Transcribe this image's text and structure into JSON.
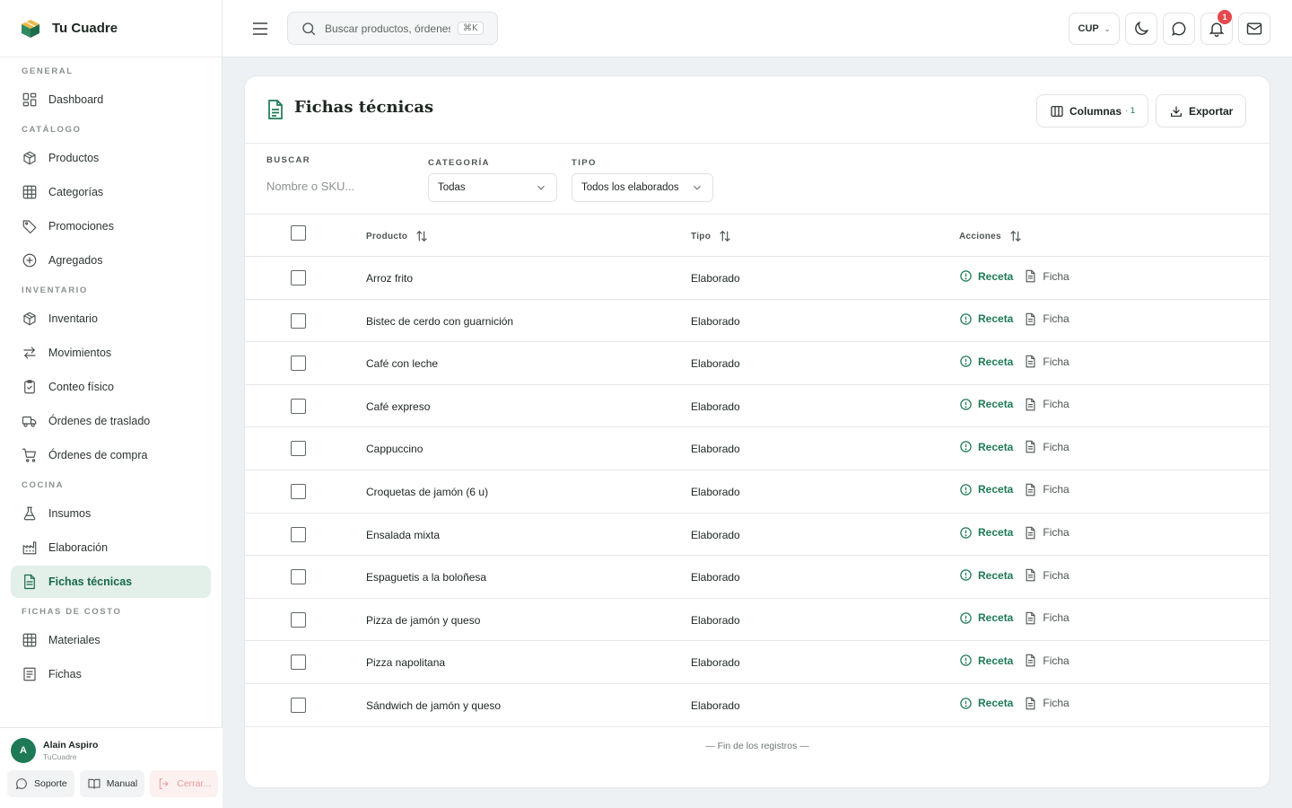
{
  "brand": {
    "name": "Tu Cuadre"
  },
  "sidebar": {
    "sections": [
      {
        "title": "GENERAL",
        "items": [
          {
            "label": "Dashboard",
            "icon": "dashboard-icon"
          }
        ]
      },
      {
        "title": "CATÁLOGO",
        "items": [
          {
            "label": "Productos",
            "icon": "box-icon"
          },
          {
            "label": "Categorías",
            "icon": "grid-icon"
          },
          {
            "label": "Promociones",
            "icon": "tag-icon"
          },
          {
            "label": "Agregados",
            "icon": "plus-circle-icon"
          }
        ]
      },
      {
        "title": "INVENTARIO",
        "items": [
          {
            "label": "Inventario",
            "icon": "box-icon"
          },
          {
            "label": "Movimientos",
            "icon": "arrows-icon"
          },
          {
            "label": "Conteo físico",
            "icon": "clipboard-icon"
          },
          {
            "label": "Órdenes de traslado",
            "icon": "truck-icon"
          },
          {
            "label": "Órdenes de compra",
            "icon": "cart-icon"
          }
        ]
      },
      {
        "title": "COCINA",
        "items": [
          {
            "label": "Insumos",
            "icon": "flask-icon"
          },
          {
            "label": "Elaboración",
            "icon": "factory-icon"
          },
          {
            "label": "Fichas técnicas",
            "icon": "document-icon",
            "active": true
          }
        ]
      },
      {
        "title": "FICHAS DE COSTO",
        "items": [
          {
            "label": "Materiales",
            "icon": "grid-icon"
          },
          {
            "label": "Fichas",
            "icon": "list-icon"
          }
        ]
      }
    ]
  },
  "user": {
    "initial": "A",
    "name": "Alain Aspiro",
    "org": "TuCuadre"
  },
  "user_actions": {
    "support": "Soporte",
    "manual": "Manual",
    "logout": "Cerrar..."
  },
  "topbar": {
    "search_placeholder": "Buscar productos, órdenes...",
    "shortcut": "⌘K",
    "currency": "CUP",
    "notifications_count": "1"
  },
  "page": {
    "title": "Fichas técnicas",
    "columns_label": "Columnas",
    "columns_count": "· 1",
    "export_label": "Exportar"
  },
  "filters": {
    "search_label": "BUSCAR",
    "search_placeholder": "Nombre o SKU...",
    "category_label": "CATEGORÍA",
    "category_value": "Todas",
    "type_label": "TIPO",
    "type_value": "Todos los elaborados"
  },
  "table": {
    "headers": {
      "product": "Producto",
      "type": "Tipo",
      "actions": "Acciones"
    },
    "action_recipe": "Receta",
    "action_sheet": "Ficha",
    "rows": [
      {
        "product": "Arroz frito",
        "type": "Elaborado"
      },
      {
        "product": "Bistec de cerdo con guarnición",
        "type": "Elaborado"
      },
      {
        "product": "Café con leche",
        "type": "Elaborado"
      },
      {
        "product": "Café expreso",
        "type": "Elaborado"
      },
      {
        "product": "Cappuccino",
        "type": "Elaborado"
      },
      {
        "product": "Croquetas de jamón (6 u)",
        "type": "Elaborado"
      },
      {
        "product": "Ensalada mixta",
        "type": "Elaborado"
      },
      {
        "product": "Espaguetis a la boloñesa",
        "type": "Elaborado"
      },
      {
        "product": "Pizza de jamón y queso",
        "type": "Elaborado"
      },
      {
        "product": "Pizza napolitana",
        "type": "Elaborado"
      },
      {
        "product": "Sándwich de jamón y queso",
        "type": "Elaborado"
      }
    ],
    "end_text": "— Fin de los registros —"
  },
  "colors": {
    "accent": "#1e7a55",
    "active_bg": "#e3efe9",
    "badge": "#e5484d"
  }
}
